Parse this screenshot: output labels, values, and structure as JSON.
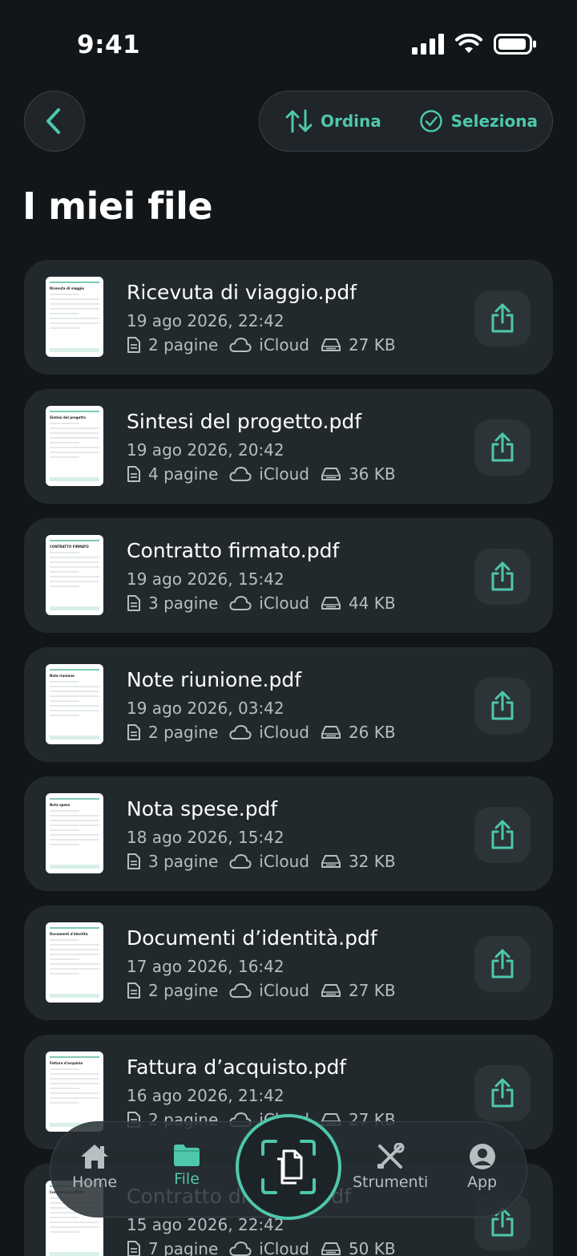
{
  "status_bar": {
    "time": "9:41"
  },
  "header": {
    "sort_label": "Ordina",
    "select_label": "Seleziona",
    "title": "I miei file"
  },
  "files": [
    {
      "name": "Ricevuta di viaggio.pdf",
      "date": "19 ago 2026, 22:42",
      "pages": "2 pagine",
      "storage": "iCloud",
      "size": "27 KB",
      "thumb_title": "Ricevuta di viaggio"
    },
    {
      "name": "Sintesi del progetto.pdf",
      "date": "19 ago 2026, 20:42",
      "pages": "4 pagine",
      "storage": "iCloud",
      "size": "36 KB",
      "thumb_title": "Sintesi del progetto"
    },
    {
      "name": "Contratto firmato.pdf",
      "date": "19 ago 2026, 15:42",
      "pages": "3 pagine",
      "storage": "iCloud",
      "size": "44 KB",
      "thumb_title": "CONTRATTO FIRMATO"
    },
    {
      "name": "Note riunione.pdf",
      "date": "19 ago 2026, 03:42",
      "pages": "2 pagine",
      "storage": "iCloud",
      "size": "26 KB",
      "thumb_title": "Note riunione"
    },
    {
      "name": "Nota spese.pdf",
      "date": "18 ago 2026, 15:42",
      "pages": "3 pagine",
      "storage": "iCloud",
      "size": "32 KB",
      "thumb_title": "Nota spese"
    },
    {
      "name": "Documenti d’identità.pdf",
      "date": "17 ago 2026, 16:42",
      "pages": "2 pagine",
      "storage": "iCloud",
      "size": "27 KB",
      "thumb_title": "Documenti d'identità"
    },
    {
      "name": "Fattura d’acquisto.pdf",
      "date": "16 ago 2026, 21:42",
      "pages": "2 pagine",
      "storage": "iCloud",
      "size": "27 KB",
      "thumb_title": "Fattura d'acquisto"
    },
    {
      "name": "Contratto di affitto.pdf",
      "date": "15 ago 2026, 22:42",
      "pages": "7 pagine",
      "storage": "iCloud",
      "size": "50 KB",
      "thumb_title": "Contratto di affitto"
    }
  ],
  "nav": {
    "home": "Home",
    "file": "File",
    "tools": "Strumenti",
    "app": "App"
  },
  "colors": {
    "accent": "#4ec7ad",
    "background": "#121619",
    "card": "#22292d"
  }
}
